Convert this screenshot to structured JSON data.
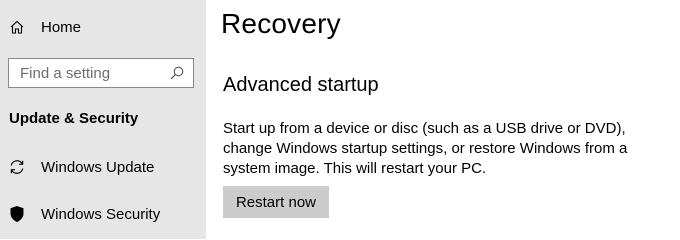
{
  "sidebar": {
    "home": {
      "label": "Home",
      "icon": "home-icon"
    },
    "search": {
      "placeholder": "Find a setting",
      "value": "",
      "icon": "search-icon"
    },
    "section_title": "Update & Security",
    "items": [
      {
        "label": "Windows Update",
        "icon": "sync-icon"
      },
      {
        "label": "Windows Security",
        "icon": "shield-icon"
      }
    ],
    "background_color": "#e6e6e6"
  },
  "main": {
    "title": "Recovery",
    "section": {
      "heading": "Advanced startup",
      "description": "Start up from a device or disc (such as a USB drive or DVD), change Windows startup settings, or restore Windows from a system image. This will restart your PC.",
      "button_label": "Restart now",
      "button_color": "#cccccc"
    }
  }
}
